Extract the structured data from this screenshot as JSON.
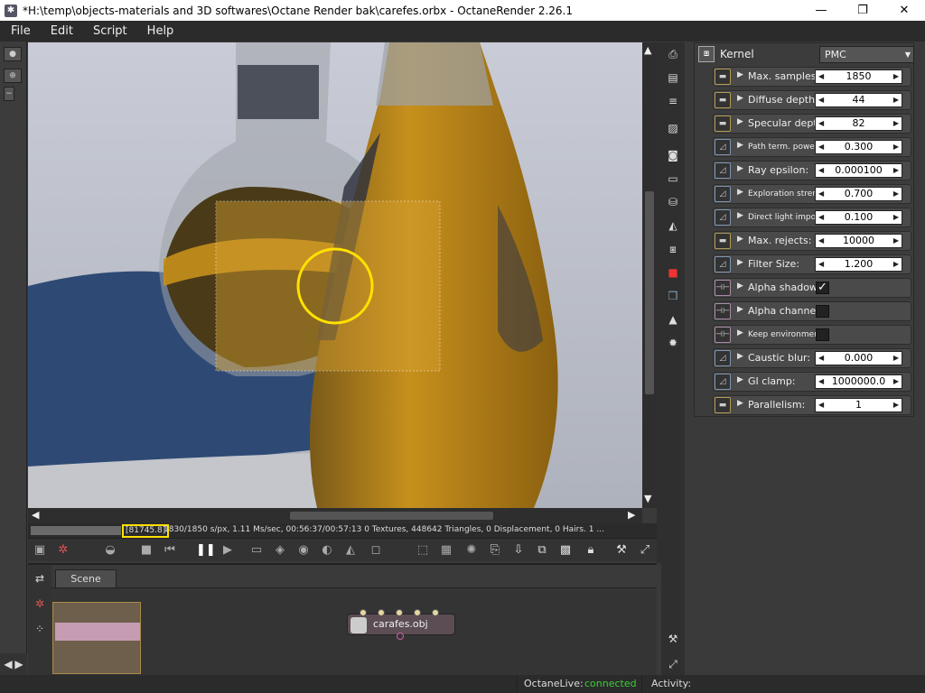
{
  "window": {
    "title": "*H:\\temp\\objects-materials and 3D softwares\\Octane Render bak\\carefes.orbx - OctaneRender 2.26.1"
  },
  "menu": [
    "File",
    "Edit",
    "Script",
    "Help"
  ],
  "render_status": {
    "samples_highlight": "[81745.8]",
    "stats": "1830/1850 s/px, 1.11 Ms/sec, 00:56:37/00:57:13   0 Textures, 448642 Triangles, 0 Displacement, 0 Hairs. 1 ..."
  },
  "kernel": {
    "label": "Kernel",
    "selected": "PMC",
    "params": [
      {
        "label": "Max. samples:",
        "value": "1850"
      },
      {
        "label": "Diffuse depth:",
        "value": "44"
      },
      {
        "label": "Specular depth:",
        "value": "82"
      },
      {
        "label": "Path term. power:",
        "value": "0.300"
      },
      {
        "label": "Ray epsilon:",
        "value": "0.000100"
      },
      {
        "label": "Exploration stren...",
        "value": "0.700"
      },
      {
        "label": "Direct light impor...",
        "value": "0.100"
      },
      {
        "label": "Max. rejects:",
        "value": "10000"
      },
      {
        "label": "Filter Size:",
        "value": "1.200"
      },
      {
        "label": "Alpha shadows:",
        "checked": "✓"
      },
      {
        "label": "Alpha channel:",
        "checked": ""
      },
      {
        "label": "Keep environment:",
        "checked": ""
      },
      {
        "label": "Caustic blur:",
        "value": "0.000"
      },
      {
        "label": "GI clamp:",
        "value": "1000000.0"
      },
      {
        "label": "Parallelism:",
        "value": "1"
      }
    ]
  },
  "scene": {
    "tab": "Scene",
    "node_label": "carafes.obj"
  },
  "statusbar": {
    "octane_live_label": "OctaneLive:",
    "octane_live_value": "connected",
    "activity_label": "Activity:"
  },
  "colors": {
    "connected": "#38d138",
    "highlight": "#ffe100",
    "liquid": "#c7901c"
  }
}
